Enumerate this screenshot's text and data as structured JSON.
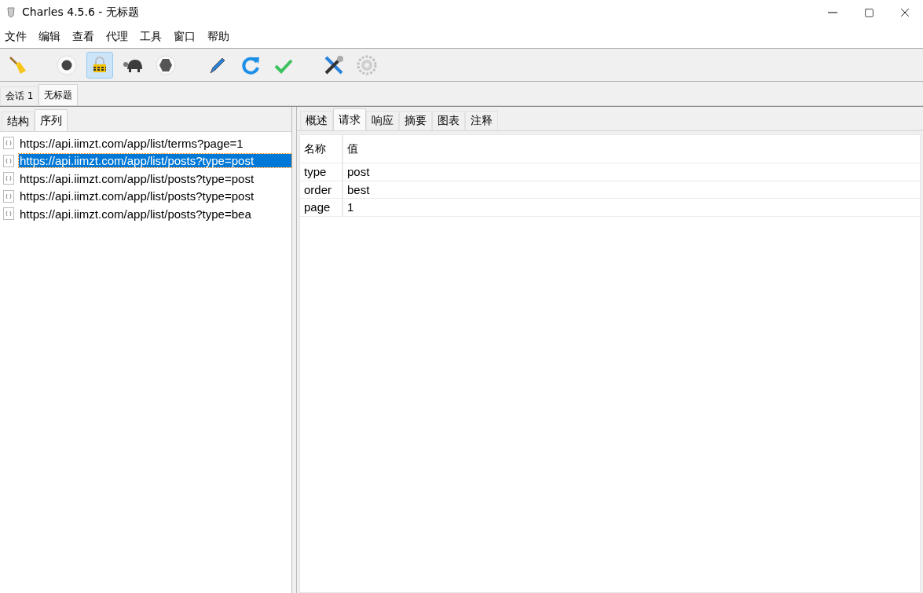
{
  "window": {
    "title": "Charles 4.5.6 - 无标题"
  },
  "menu": [
    "文件",
    "编辑",
    "查看",
    "代理",
    "工具",
    "窗口",
    "帮助"
  ],
  "toolbar": [
    {
      "kind": "broom",
      "on": false,
      "disabled": false
    },
    {
      "kind": "record",
      "on": false,
      "disabled": false
    },
    {
      "kind": "throttle",
      "on": true,
      "disabled": false
    },
    {
      "kind": "turtle",
      "on": false,
      "disabled": false
    },
    {
      "kind": "stop",
      "on": false,
      "disabled": false
    },
    {
      "kind": "pen",
      "on": false,
      "disabled": false
    },
    {
      "kind": "refresh",
      "on": false,
      "disabled": false
    },
    {
      "kind": "check",
      "on": false,
      "disabled": false
    },
    {
      "kind": "tools",
      "on": false,
      "disabled": false
    },
    {
      "kind": "gear",
      "on": false,
      "disabled": true
    }
  ],
  "session_tabs": [
    {
      "label": "会话 1",
      "selected": false
    },
    {
      "label": "无标题",
      "selected": true
    }
  ],
  "left_tabs": [
    {
      "label": "结构",
      "selected": false
    },
    {
      "label": "序列",
      "selected": true
    }
  ],
  "requests": [
    {
      "url": "https://api.iimzt.com/app/list/terms?page=1",
      "selected": false
    },
    {
      "url": "https://api.iimzt.com/app/list/posts?type=post",
      "selected": true
    },
    {
      "url": "https://api.iimzt.com/app/list/posts?type=post",
      "selected": false
    },
    {
      "url": "https://api.iimzt.com/app/list/posts?type=post",
      "selected": false
    },
    {
      "url": "https://api.iimzt.com/app/list/posts?type=bea",
      "selected": false
    }
  ],
  "right_tabs": [
    {
      "label": "概述",
      "selected": false
    },
    {
      "label": "请求",
      "selected": true
    },
    {
      "label": "响应",
      "selected": false
    },
    {
      "label": "摘要",
      "selected": false
    },
    {
      "label": "图表",
      "selected": false
    },
    {
      "label": "注释",
      "selected": false
    }
  ],
  "table": {
    "columns": [
      "名称",
      "值"
    ],
    "rows": [
      [
        "type",
        "post"
      ],
      [
        "order",
        "best"
      ],
      [
        "page",
        "1"
      ]
    ]
  }
}
